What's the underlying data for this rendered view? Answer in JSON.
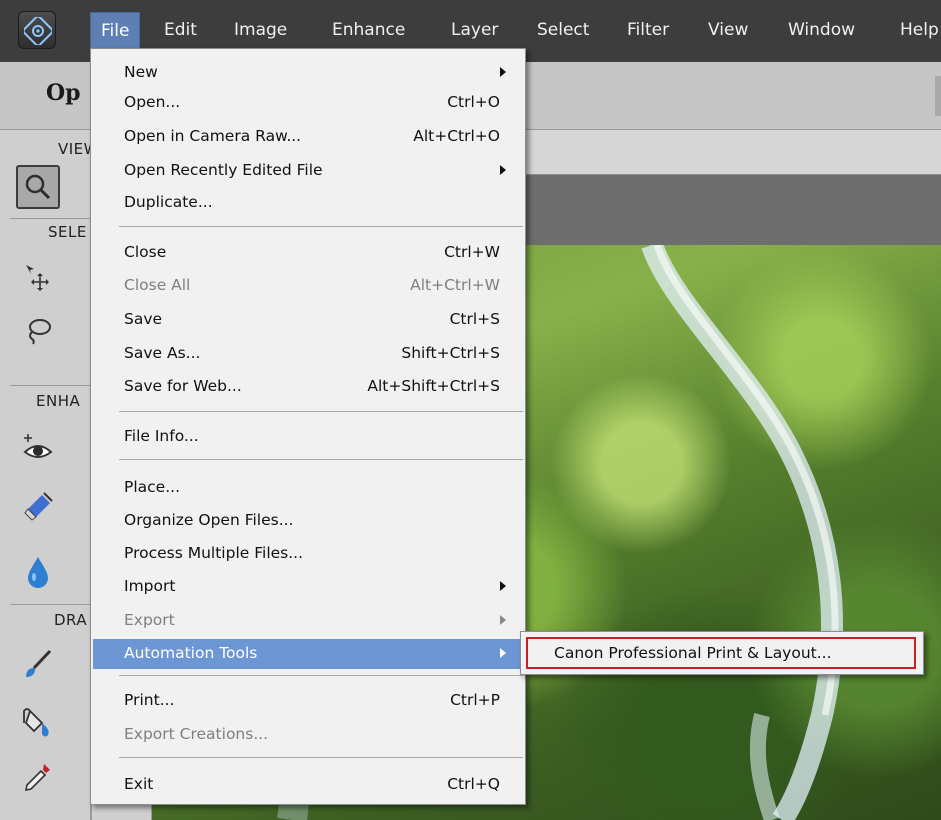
{
  "menubar": {
    "items": [
      "File",
      "Edit",
      "Image",
      "Enhance",
      "Layer",
      "Select",
      "Filter",
      "View",
      "Window",
      "Help"
    ],
    "active": "File",
    "active_color": "#5d7fb3"
  },
  "options_bar": {
    "title": "Op"
  },
  "tool_panel": {
    "sections": [
      "VIEW",
      "SELE",
      "ENHA",
      "DRA"
    ],
    "tools": [
      "zoom-icon",
      "move-icon",
      "lasso-icon",
      "red-eye-icon",
      "spot-healing-icon",
      "blur-icon",
      "brush-icon",
      "paint-bucket-icon",
      "eyedropper-icon"
    ]
  },
  "file_menu": {
    "highlight_color": "#6d97d4",
    "items": [
      {
        "label": "New",
        "shortcut": "",
        "submenu": true,
        "disabled": false
      },
      {
        "label": "Open...",
        "shortcut": "Ctrl+O",
        "submenu": false,
        "disabled": false
      },
      {
        "label": "Open in Camera Raw...",
        "shortcut": "Alt+Ctrl+O",
        "submenu": false,
        "disabled": false
      },
      {
        "label": "Open Recently Edited File",
        "shortcut": "",
        "submenu": true,
        "disabled": false
      },
      {
        "label": "Duplicate...",
        "shortcut": "",
        "submenu": false,
        "disabled": false
      },
      {
        "label": "Close",
        "shortcut": "Ctrl+W",
        "submenu": false,
        "disabled": false
      },
      {
        "label": "Close All",
        "shortcut": "Alt+Ctrl+W",
        "submenu": false,
        "disabled": true
      },
      {
        "label": "Save",
        "shortcut": "Ctrl+S",
        "submenu": false,
        "disabled": false
      },
      {
        "label": "Save As...",
        "shortcut": "Shift+Ctrl+S",
        "submenu": false,
        "disabled": false
      },
      {
        "label": "Save for Web...",
        "shortcut": "Alt+Shift+Ctrl+S",
        "submenu": false,
        "disabled": false
      },
      {
        "label": "File Info...",
        "shortcut": "",
        "submenu": false,
        "disabled": false
      },
      {
        "label": "Place...",
        "shortcut": "",
        "submenu": false,
        "disabled": false
      },
      {
        "label": "Organize Open Files...",
        "shortcut": "",
        "submenu": false,
        "disabled": false
      },
      {
        "label": "Process Multiple Files...",
        "shortcut": "",
        "submenu": false,
        "disabled": false
      },
      {
        "label": "Import",
        "shortcut": "",
        "submenu": true,
        "disabled": false
      },
      {
        "label": "Export",
        "shortcut": "",
        "submenu": true,
        "disabled": true
      },
      {
        "label": "Automation Tools",
        "shortcut": "",
        "submenu": true,
        "disabled": false,
        "highlighted": true
      },
      {
        "label": "Print...",
        "shortcut": "Ctrl+P",
        "submenu": false,
        "disabled": false
      },
      {
        "label": "Export Creations...",
        "shortcut": "",
        "submenu": false,
        "disabled": true
      },
      {
        "label": "Exit",
        "shortcut": "Ctrl+Q",
        "submenu": false,
        "disabled": false
      }
    ]
  },
  "submenu": {
    "items": [
      "Canon Professional Print & Layout..."
    ],
    "outline_color": "#c8202a"
  }
}
